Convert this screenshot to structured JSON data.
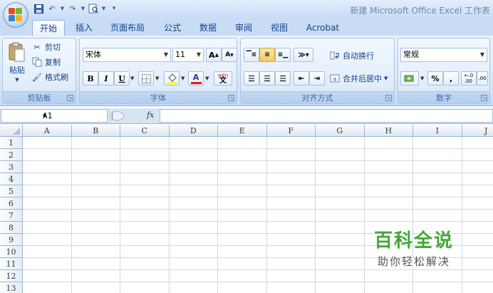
{
  "app": {
    "title": "新建 Microsoft Office Excel 工作表",
    "office_button_icon": "office-logo-icon",
    "quick_access": [
      "save-icon",
      "undo-icon",
      "redo-icon",
      "print-preview-icon",
      "customize-qat-icon"
    ]
  },
  "tabs": [
    "开始",
    "插入",
    "页面布局",
    "公式",
    "数据",
    "审阅",
    "视图",
    "Acrobat"
  ],
  "active_tab": "开始",
  "ribbon": {
    "clipboard": {
      "label": "剪贴板",
      "paste": "粘贴",
      "cut": "剪切",
      "copy": "复制",
      "format_painter": "格式刷"
    },
    "font": {
      "label": "字体",
      "font_name": "宋体",
      "font_size": "11",
      "grow": "A",
      "shrink": "A",
      "bold": "B",
      "italic": "I",
      "underline": "U",
      "font_color_letter": "A",
      "phonetic": "wén"
    },
    "alignment": {
      "label": "对齐方式",
      "wrap_text": "自动换行",
      "merge_center": "合并后居中"
    },
    "number": {
      "label": "数字",
      "format": "常规",
      "percent": "%",
      "comma": ","
    }
  },
  "formula_bar": {
    "name_box": "A1",
    "fx": "fx",
    "formula": ""
  },
  "sheet": {
    "columns": [
      "A",
      "B",
      "C",
      "D",
      "E",
      "F",
      "G",
      "H",
      "I",
      "J"
    ],
    "rows": [
      "1",
      "2",
      "3",
      "4",
      "5",
      "6",
      "7",
      "8",
      "9",
      "10",
      "11",
      "12",
      "13"
    ]
  },
  "watermark": {
    "main": "百科全说",
    "sub": "助你轻松解决"
  },
  "colors": {
    "ribbon_text": "#15428b",
    "tab_bar": "#c9dcf5",
    "active_toggle": "#f8c85f",
    "watermark_green": "#43a838"
  }
}
